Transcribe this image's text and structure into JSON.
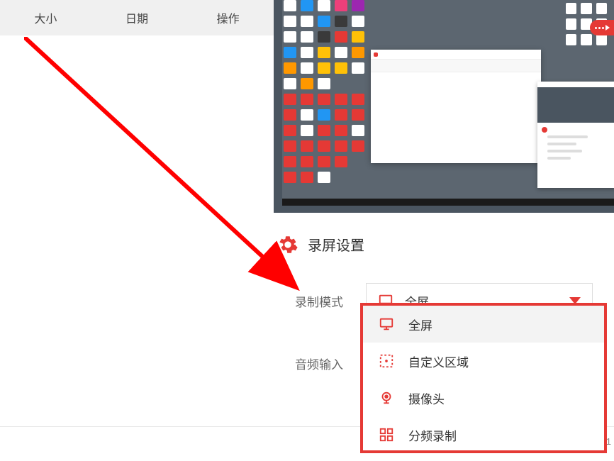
{
  "tabs": {
    "size": "大小",
    "date": "日期",
    "action": "操作"
  },
  "settings": {
    "title": "录屏设置",
    "record_mode_label": "录制模式",
    "audio_input_label": "音频输入"
  },
  "dropdown": {
    "selected": "全屏",
    "options": [
      {
        "label": "全屏",
        "icon": "monitor"
      },
      {
        "label": "自定义区域",
        "icon": "selection"
      },
      {
        "label": "摄像头",
        "icon": "webcam"
      },
      {
        "label": "分频录制",
        "icon": "grid"
      }
    ]
  },
  "version": ".1",
  "colors": {
    "accent": "#e53935",
    "text": "#333",
    "muted": "#666"
  }
}
